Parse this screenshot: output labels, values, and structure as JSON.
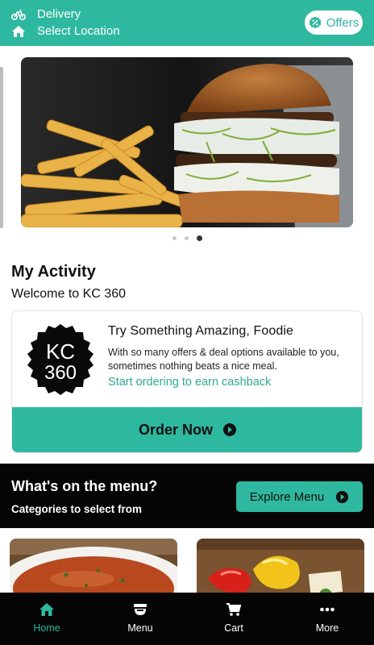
{
  "header": {
    "delivery_label": "Delivery",
    "location_label": "Select Location",
    "offers_label": "Offers"
  },
  "carousel": {
    "slide_count": 3,
    "active_index": 2
  },
  "activity": {
    "title": "My Activity",
    "subtitle": "Welcome to KC 360",
    "card": {
      "logo_line1": "KC",
      "logo_line2": "360",
      "title": "Try Something Amazing, Foodie",
      "description": "With so many offers & deal options available to you, sometimes nothing beats a nice meal.",
      "link": "Start ordering to earn cashback",
      "button": "Order Now"
    }
  },
  "menu_section": {
    "title": "What's on the menu?",
    "subtitle": "Categories to select from",
    "button": "Explore Menu"
  },
  "bottom_nav": [
    {
      "label": "Home",
      "icon": "home-icon",
      "active": true
    },
    {
      "label": "Menu",
      "icon": "menu-icon",
      "active": false
    },
    {
      "label": "Cart",
      "icon": "cart-icon",
      "active": false
    },
    {
      "label": "More",
      "icon": "more-icon",
      "active": false
    }
  ],
  "colors": {
    "brand": "#2fb8a0",
    "dark": "#050505"
  }
}
